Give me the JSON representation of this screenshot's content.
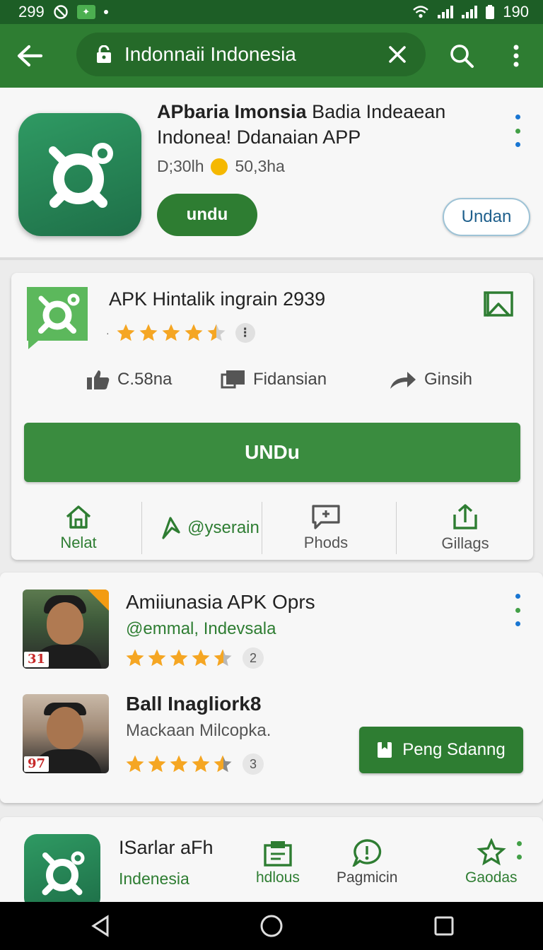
{
  "status_bar": {
    "time": "299",
    "battery": "190"
  },
  "search": {
    "query": "Indonnaii Indonesia"
  },
  "app_header": {
    "title_bold": "APbaria Imonsia",
    "title_rest": " Badia Indeaean Indonea!  Ddanaian APP",
    "meta_left": "D;30lh",
    "meta_right": "50,3ha",
    "install_label": "undu",
    "secondary_label": "Undan"
  },
  "card1": {
    "title": "APK Hintalik ingrain 2939",
    "rating": 4.5,
    "actions": [
      {
        "label": "C.58na",
        "icon": "thumb-up-icon"
      },
      {
        "label": "Fidansian",
        "icon": "flag-icon"
      },
      {
        "label": "Ginsih",
        "icon": "share-arrow-icon"
      }
    ],
    "main_button": "UNDu",
    "tabs": [
      {
        "label": "Nelat",
        "icon": "home-icon"
      },
      {
        "label": "@yserain",
        "icon": "send-icon"
      },
      {
        "label": "Phods",
        "icon": "chat-icon"
      },
      {
        "label": "Gillags",
        "icon": "upload-icon"
      }
    ]
  },
  "card2": {
    "users": [
      {
        "name": "Amiiunasia APK Oprs",
        "handle": "@emmal, Indevsala",
        "badge": "31",
        "rating": 4.5,
        "count": "2"
      },
      {
        "name": "Ball Inagliork8",
        "handle": "Mackaan Milcopka.",
        "badge": "97",
        "rating": 4.5,
        "count": "3"
      }
    ],
    "button_label": "Peng Sdanng"
  },
  "card3": {
    "title": "ISarlar aFh",
    "subtitle": "Indenesia",
    "actions": [
      {
        "label": "hdlous",
        "icon": "clipboard-icon"
      },
      {
        "label": "Pagmicin",
        "icon": "chat-bubble-icon"
      },
      {
        "label": "Gaodas",
        "icon": "star-outline-icon"
      }
    ]
  },
  "colors": {
    "primary": "#2e7d32",
    "status_bar": "#1d5e26",
    "star": "#f5a623",
    "link": "#1e5f8c"
  }
}
